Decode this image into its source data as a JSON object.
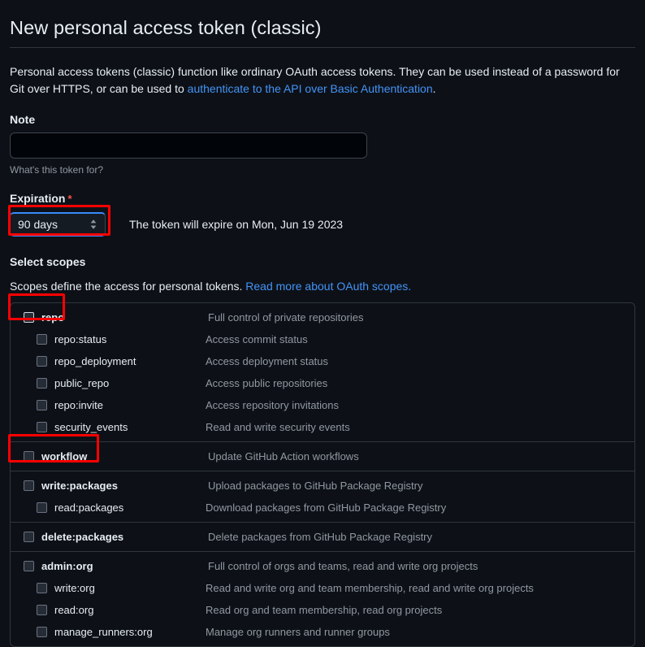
{
  "header": {
    "title": "New personal access token (classic)"
  },
  "intro": {
    "text_before": "Personal access tokens (classic) function like ordinary OAuth access tokens. They can be used instead of a password for Git over HTTPS, or can be used to ",
    "link_text": "authenticate to the API over Basic Authentication",
    "text_after": "."
  },
  "note_field": {
    "label": "Note",
    "value": "",
    "placeholder": "",
    "hint": "What's this token for?"
  },
  "expiration": {
    "label": "Expiration",
    "required_marker": "*",
    "selected": "90 days",
    "help": "The token will expire on Mon, Jun 19 2023",
    "stepper_icon": "chevron-up-down-icon"
  },
  "scopes": {
    "heading": "Select scopes",
    "description_before": "Scopes define the access for personal tokens. ",
    "description_link": "Read more about OAuth scopes.",
    "groups": [
      {
        "rows": [
          {
            "name": "repo",
            "desc": "Full control of private repositories",
            "level": 0,
            "bold": true,
            "checked": false,
            "highlight": true,
            "desc_indent": true
          },
          {
            "name": "repo:status",
            "desc": "Access commit status",
            "level": 1,
            "bold": false,
            "checked": false,
            "highlight": false,
            "desc_indent": false
          },
          {
            "name": "repo_deployment",
            "desc": "Access deployment status",
            "level": 1,
            "bold": false,
            "checked": false,
            "highlight": false,
            "desc_indent": false
          },
          {
            "name": "public_repo",
            "desc": "Access public repositories",
            "level": 1,
            "bold": false,
            "checked": false,
            "highlight": false,
            "desc_indent": false
          },
          {
            "name": "repo:invite",
            "desc": "Access repository invitations",
            "level": 1,
            "bold": false,
            "checked": false,
            "highlight": false,
            "desc_indent": false
          },
          {
            "name": "security_events",
            "desc": "Read and write security events",
            "level": 1,
            "bold": false,
            "checked": false,
            "highlight": false,
            "desc_indent": false
          }
        ]
      },
      {
        "rows": [
          {
            "name": "workflow",
            "desc": "Update GitHub Action workflows",
            "level": 0,
            "bold": true,
            "checked": false,
            "highlight": false,
            "desc_indent": true
          }
        ]
      },
      {
        "rows": [
          {
            "name": "write:packages",
            "desc": "Upload packages to GitHub Package Registry",
            "level": 0,
            "bold": true,
            "checked": false,
            "highlight": false,
            "desc_indent": true
          },
          {
            "name": "read:packages",
            "desc": "Download packages from GitHub Package Registry",
            "level": 1,
            "bold": false,
            "checked": false,
            "highlight": false,
            "desc_indent": false
          }
        ]
      },
      {
        "rows": [
          {
            "name": "delete:packages",
            "desc": "Delete packages from GitHub Package Registry",
            "level": 0,
            "bold": true,
            "checked": false,
            "highlight": false,
            "desc_indent": true
          }
        ]
      },
      {
        "rows": [
          {
            "name": "admin:org",
            "desc": "Full control of orgs and teams, read and write org projects",
            "level": 0,
            "bold": true,
            "checked": false,
            "highlight": false,
            "desc_indent": true
          },
          {
            "name": "write:org",
            "desc": "Read and write org and team membership, read and write org projects",
            "level": 1,
            "bold": false,
            "checked": false,
            "highlight": false,
            "desc_indent": false
          },
          {
            "name": "read:org",
            "desc": "Read org and team membership, read org projects",
            "level": 1,
            "bold": false,
            "checked": false,
            "highlight": false,
            "desc_indent": false
          },
          {
            "name": "manage_runners:org",
            "desc": "Manage org runners and runner groups",
            "level": 1,
            "bold": false,
            "checked": false,
            "highlight": false,
            "desc_indent": false
          }
        ]
      }
    ]
  },
  "colors": {
    "background": "#0d1117",
    "text": "#e6edf3",
    "muted": "#9198a1",
    "link": "#4493f8",
    "border": "#30363d",
    "required": "#f85149",
    "annotation": "#ff0000",
    "focus": "#388bfd"
  }
}
